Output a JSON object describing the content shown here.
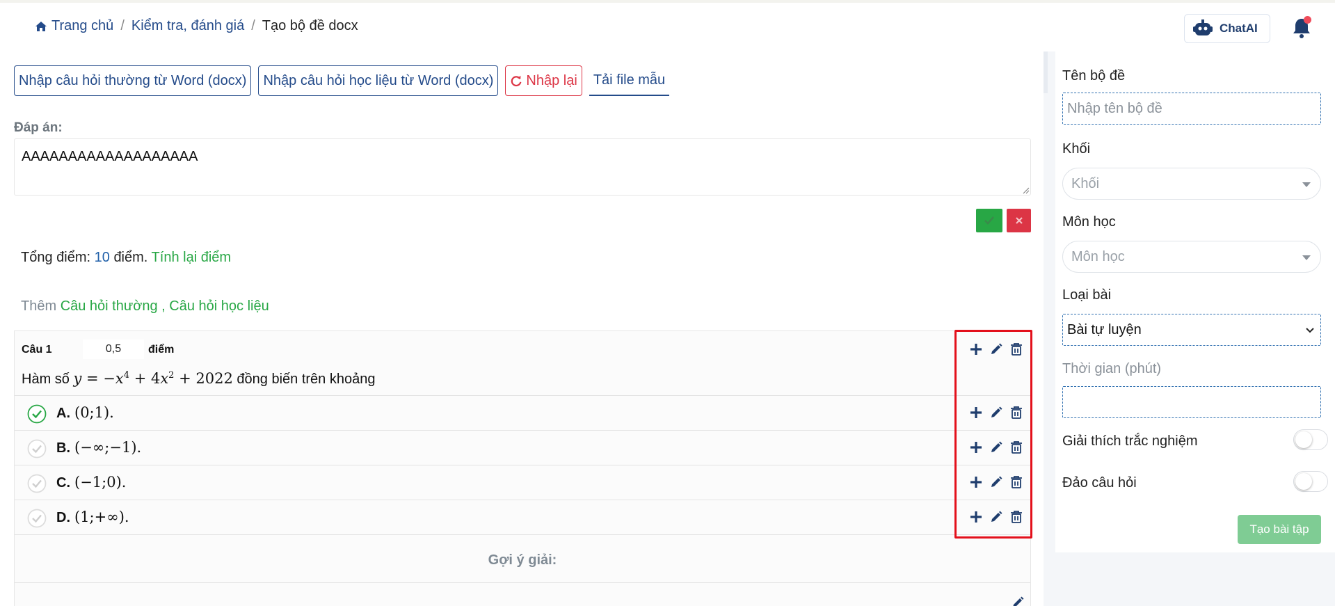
{
  "breadcrumb": {
    "home": "Trang chủ",
    "section": "Kiểm tra, đánh giá",
    "current": "Tạo bộ đề docx",
    "separator": "/"
  },
  "header": {
    "chat_label": "ChatAI"
  },
  "toolbar": {
    "import_word": "Nhập câu hỏi thường từ Word (docx)",
    "import_material": "Nhập câu hỏi học liệu từ Word (docx)",
    "reset": "Nhập lại",
    "download_template": "Tải file mẫu"
  },
  "answer": {
    "label": "Đáp án:",
    "value": "AAAAAAAAAAAAAAAAAAA"
  },
  "score": {
    "prefix": "Tổng điểm:",
    "total": "10",
    "suffix": "điểm.",
    "recalc": "Tính lại điểm"
  },
  "add": {
    "prefix": "Thêm",
    "normal": "Câu hỏi thường ,",
    "material": "Câu hỏi học liệu"
  },
  "question": {
    "label": "Câu 1",
    "points": "0,5",
    "points_unit": "điểm",
    "text_prefix": "Hàm số",
    "text_suffix": "đồng biến trên khoảng",
    "options": [
      {
        "letter": "A.",
        "text": "(0;1).",
        "correct": true
      },
      {
        "letter": "B.",
        "text": "(−∞;−1).",
        "correct": false
      },
      {
        "letter": "C.",
        "text": "(−1;0).",
        "correct": false
      },
      {
        "letter": "D.",
        "text": "(1;+∞).",
        "correct": false
      }
    ],
    "hint_label": "Gợi ý giải:"
  },
  "panel": {
    "title_label": "Tên bộ đề",
    "title_placeholder": "Nhập tên bộ đề",
    "grade_label": "Khối",
    "grade_placeholder": "Khối",
    "subject_label": "Môn học",
    "subject_placeholder": "Môn học",
    "type_label": "Loại bài",
    "type_value": "Bài tự luyện",
    "time_label": "Thời gian (phút)",
    "explain_label": "Giải thích trắc nghiệm",
    "shuffle_label": "Đảo câu hỏi",
    "create_button": "Tạo bài tập"
  },
  "colors": {
    "primary": "#244b8a",
    "success": "#28a745",
    "danger": "#dc3545",
    "highlight": "#e3101b"
  }
}
